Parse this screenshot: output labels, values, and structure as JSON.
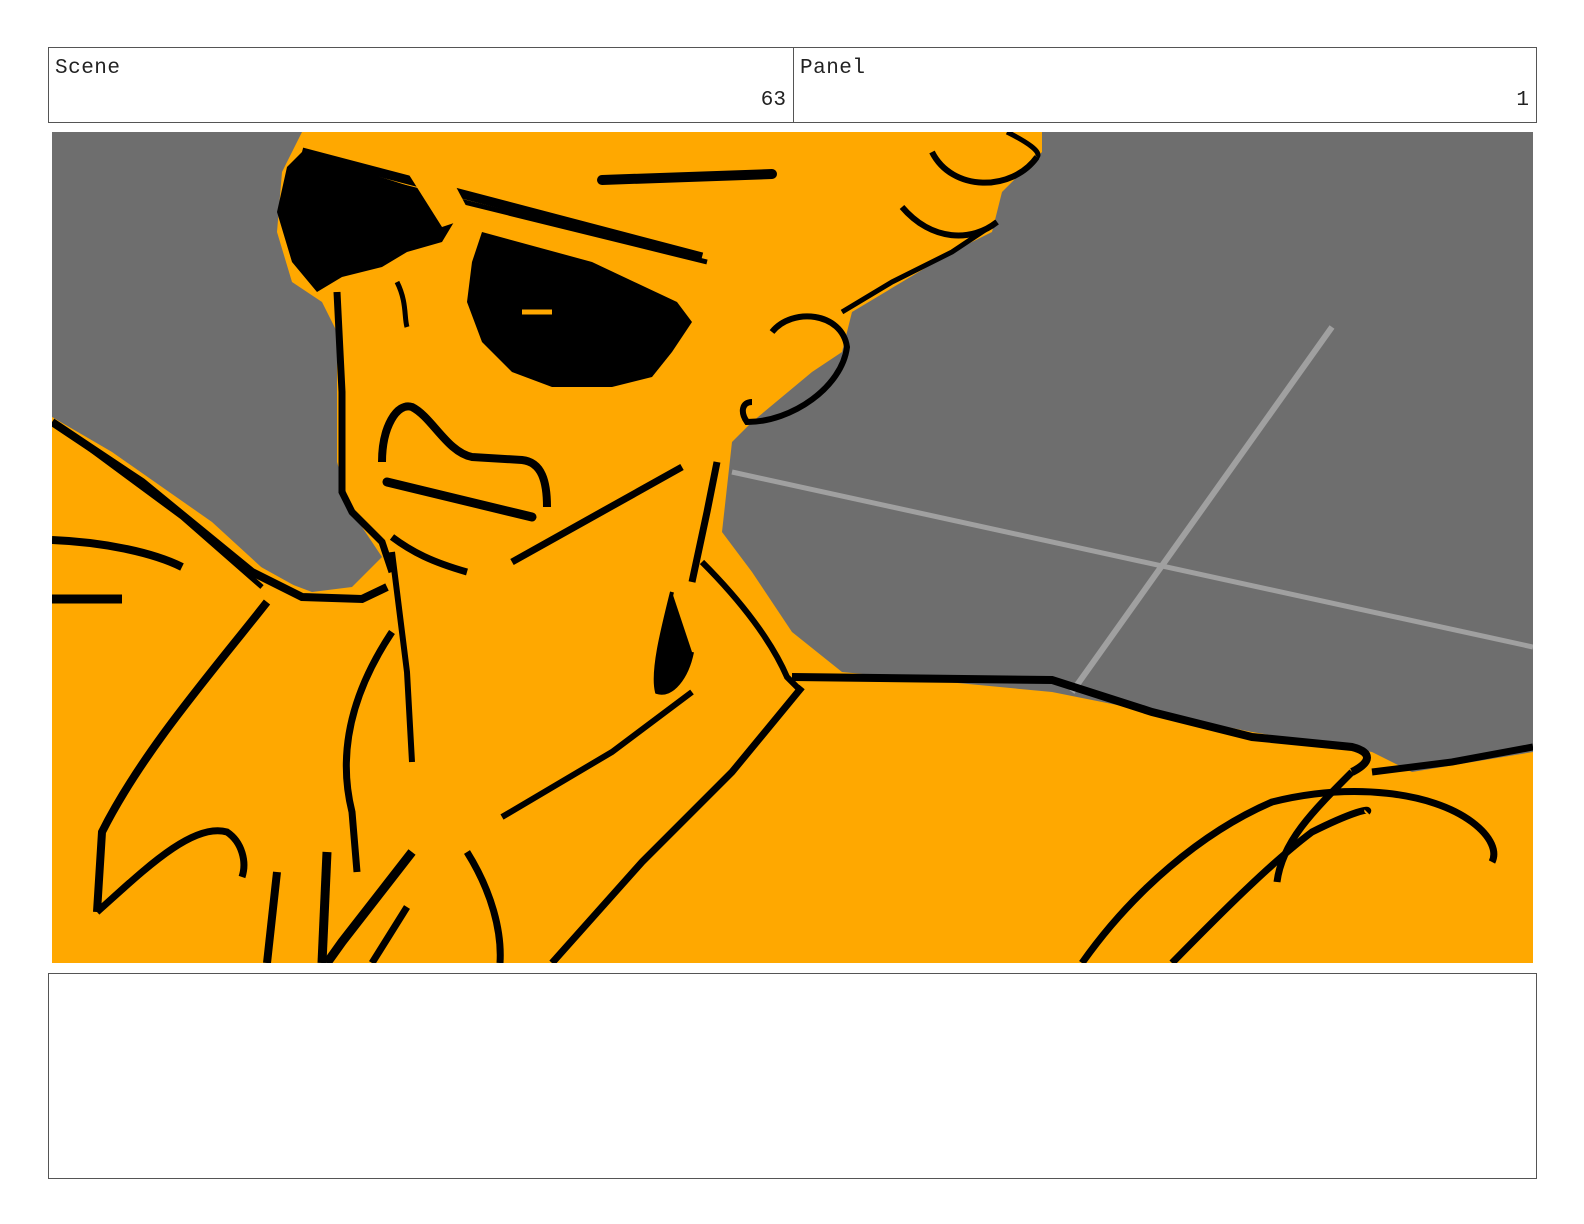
{
  "header": {
    "scene_label": "Scene",
    "scene_number": "63",
    "panel_label": "Panel",
    "panel_number": "1"
  },
  "frame": {
    "colors": {
      "background_gray": "#6e6e6e",
      "skin_orange": "#ffa800",
      "ink": "#000000",
      "guide_line": "#a0a0a0"
    }
  },
  "notes": {
    "text": ""
  }
}
